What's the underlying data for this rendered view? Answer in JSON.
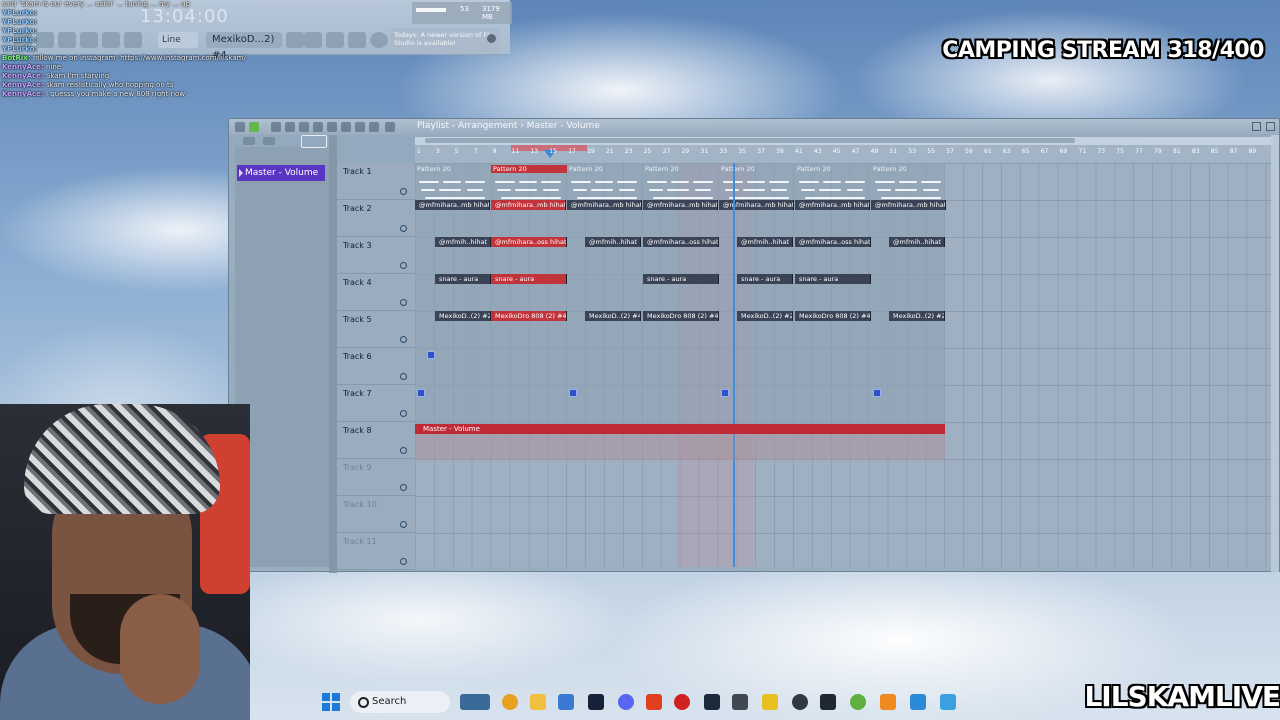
{
  "fl_top": {
    "time_display": "13:04:00",
    "meter_value": "53",
    "meter_mb": "3179 MB",
    "meter_sub": "6",
    "line_select": "Line",
    "pattern_select": "MexikoD...2) #4",
    "news_text": "Todays: A newer version of FL Studio is available!"
  },
  "chat": [
    {
      "user": "",
      "text": "said \"skam is our every ... ustin' ... tuning ... my ... up",
      "color": "#f0f0f0"
    },
    {
      "user": "YPLurko:",
      "text": "",
      "color": "#8cc8ff"
    },
    {
      "user": "YPLurko:",
      "text": "",
      "color": "#8cc8ff"
    },
    {
      "user": "YPLurko:",
      "text": "",
      "color": "#8cc8ff"
    },
    {
      "user": "YPLurko:",
      "text": "",
      "color": "#8cc8ff"
    },
    {
      "user": "YPLurko:",
      "text": "",
      "color": "#8cc8ff"
    },
    {
      "user": "BotRix:",
      "text": "follow me on instagram: https://www.instagram.com/lilskam/",
      "color": "#7cf07c"
    },
    {
      "user": "KennyAce:",
      "text": "nine",
      "color": "#c8a0ff"
    },
    {
      "user": "KennyAce:",
      "text": "Skam I'm starving",
      "color": "#c8a0ff"
    },
    {
      "user": "KennyAce:",
      "text": "skam realistically who hopping on ts",
      "color": "#c8a0ff"
    },
    {
      "user": "KennyAce:",
      "text": "I guesss you make a new 808 right now",
      "color": "#c8a0ff"
    }
  ],
  "banner": "CAMPING STREAM 318/400",
  "channel": "LILSKAMLIVE",
  "playlist": {
    "title": "Playlist - Arrangement › Master - Volume",
    "selected": "Master - Volume",
    "ruler": [
      "1",
      "3",
      "5",
      "7",
      "9",
      "11",
      "13",
      "15",
      "17",
      "19",
      "21",
      "23",
      "25",
      "27",
      "29",
      "31",
      "33",
      "35",
      "37",
      "39",
      "41",
      "43",
      "45",
      "47",
      "49",
      "51",
      "53",
      "55",
      "57",
      "59",
      "61",
      "63",
      "65",
      "67",
      "69",
      "71",
      "73",
      "75",
      "77",
      "79",
      "81",
      "83",
      "85",
      "87",
      "89"
    ],
    "tracks": [
      "Track 1",
      "Track 2",
      "Track 3",
      "Track 4",
      "Track 5",
      "Track 6",
      "Track 7",
      "Track 8",
      "Track 9",
      "Track 10",
      "Track 11"
    ],
    "clips": {
      "pattern": "Pattern 20",
      "hihat": "@mfmihara..mb hihat",
      "hihat2": "@mfmih..hihat",
      "oss": "@mfmihara..oss hihat",
      "snare": "snare - aura",
      "mexiko1": "MexikoD..(2) #2",
      "mexiko2": "MexikoDro 808 (2) #4",
      "mexiko3": "MexikoD..(2) #4",
      "auto": "Master - Volume"
    }
  },
  "taskbar": {
    "search": "Search"
  }
}
